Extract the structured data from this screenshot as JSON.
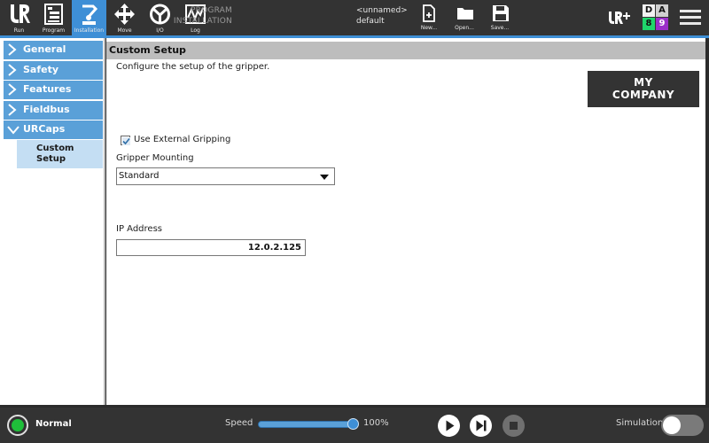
{
  "topbar": {
    "nav": [
      {
        "label": "Run",
        "icon": "ur-logo-icon"
      },
      {
        "label": "Program",
        "icon": "program-icon"
      },
      {
        "label": "Installation",
        "icon": "installation-icon",
        "active": true
      },
      {
        "label": "Move",
        "icon": "move-icon"
      },
      {
        "label": "I/O",
        "icon": "io-icon"
      },
      {
        "label": "Log",
        "icon": "log-icon"
      }
    ],
    "program_key": "PROGRAM",
    "program_value": "<unnamed>",
    "installation_key": "INSTALLATION",
    "installation_value": "default",
    "file_buttons": [
      {
        "label": "New...",
        "icon": "new-file-icon"
      },
      {
        "label": "Open...",
        "icon": "folder-icon"
      },
      {
        "label": "Save...",
        "icon": "save-icon"
      }
    ],
    "da": {
      "d": "D",
      "a": "A",
      "d_count": "8",
      "a_count": "9"
    },
    "colors": {
      "accent": "#3e8fd6",
      "bar": "#333333",
      "d_badge": "#1fd66b",
      "a_badge": "#9b2fc9"
    }
  },
  "sidebar": {
    "items": [
      {
        "label": "General",
        "expanded": false
      },
      {
        "label": "Safety",
        "expanded": false
      },
      {
        "label": "Features",
        "expanded": false
      },
      {
        "label": "Fieldbus",
        "expanded": false
      },
      {
        "label": "URCaps",
        "expanded": true
      }
    ],
    "sub_item": {
      "line1": "Custom",
      "line2": "Setup"
    }
  },
  "main": {
    "header": "Custom Setup",
    "description": "Configure the setup of the gripper.",
    "logo_line1": "MY",
    "logo_line2": "COMPANY",
    "checkbox_label": "Use External Gripping",
    "checkbox_checked": true,
    "mounting_label": "Gripper Mounting",
    "mounting_value": "Standard",
    "ip_label": "IP Address",
    "ip_value": "12.0.2.125"
  },
  "bottombar": {
    "status": "Normal",
    "speed_label": "Speed",
    "speed_value": "100%",
    "speed_fraction": 1.0,
    "simulation_label": "Simulation",
    "simulation_on": false
  }
}
